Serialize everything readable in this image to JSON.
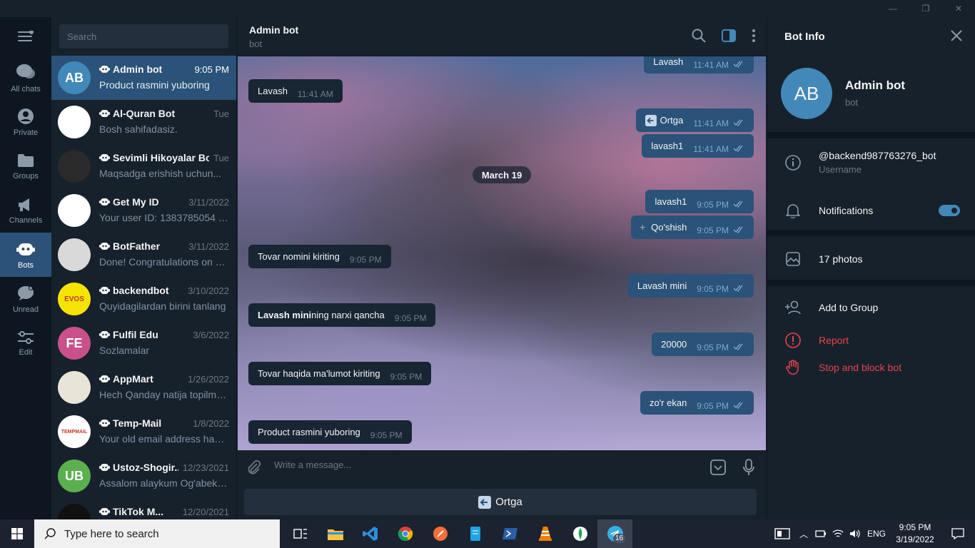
{
  "window": {
    "minimize": "—",
    "maximize": "❐",
    "close": "✕"
  },
  "folders": [
    {
      "label": "All chats",
      "icon": "all-chats-icon",
      "active": false
    },
    {
      "label": "Private",
      "icon": "person-icon",
      "active": false
    },
    {
      "label": "Groups",
      "icon": "folder-icon",
      "active": false
    },
    {
      "label": "Channels",
      "icon": "megaphone-icon",
      "active": false
    },
    {
      "label": "Bots",
      "icon": "bot-icon",
      "active": true
    },
    {
      "label": "Unread",
      "icon": "chat-bubble-icon",
      "active": false
    },
    {
      "label": "Edit",
      "icon": "sliders-icon",
      "active": false
    }
  ],
  "search": {
    "placeholder": "Search"
  },
  "chats": [
    {
      "name": "Admin bot",
      "time": "9:05 PM",
      "message": "Product rasmini yuboring",
      "avatar_text": "AB",
      "avatar_color": "#4288b9",
      "active": true
    },
    {
      "name": "Al-Quran Bot",
      "time": "Tue",
      "message": "Bosh sahifadasiz.",
      "avatar_text": "",
      "avatar_color": "#ffffff"
    },
    {
      "name": "Sevimli Hikoyalar Bot",
      "time": "Tue",
      "message": "Maqsadga erishish uchun...",
      "avatar_text": "",
      "avatar_color": "#2a2a2a"
    },
    {
      "name": "Get My ID",
      "time": "3/11/2022",
      "message": "Your user ID: 1383785054 Cur...",
      "avatar_text": "",
      "avatar_color": "#ffffff"
    },
    {
      "name": "BotFather",
      "time": "3/11/2022",
      "message": "Done! Congratulations on yo...",
      "avatar_text": "",
      "avatar_color": "#d9d9d9"
    },
    {
      "name": "backendbot",
      "time": "3/10/2022",
      "message": "Quyidagilardan birini tanlang",
      "avatar_text": "EVOS",
      "avatar_color": "#f5e400"
    },
    {
      "name": "Fulfil Edu",
      "time": "3/6/2022",
      "message": "Sozlamalar",
      "avatar_text": "FE",
      "avatar_color": "#c9508a"
    },
    {
      "name": "AppMart",
      "time": "1/26/2022",
      "message": "Hech Qanday natija topilmadi.",
      "avatar_text": "",
      "avatar_color": "#e8e4d8"
    },
    {
      "name": "Temp-Mail",
      "time": "1/8/2022",
      "message": "Your old email address has b...",
      "avatar_text": "TEMPMAIL",
      "avatar_color": "#ffffff"
    },
    {
      "name": "Ustoz-Shogir...",
      "time": "12/23/2021",
      "message": "Assalom alaykum Og'abek U...",
      "avatar_text": "UB",
      "avatar_color": "#5caf4f"
    },
    {
      "name": "TikTok M...",
      "time": "12/20/2021",
      "message": "",
      "avatar_text": "",
      "avatar_color": "#111111"
    }
  ],
  "header": {
    "title": "Admin bot",
    "subtitle": "bot"
  },
  "messages": [
    {
      "text": "Lavash",
      "time": "11:41 AM",
      "out": true
    },
    {
      "text": "Lavash",
      "time": "11:41 AM",
      "out": false
    },
    {
      "text": "Ortga",
      "time": "11:41 AM",
      "out": true
    },
    {
      "text": "lavash1",
      "time": "11:41 AM",
      "out": true
    },
    {
      "text": "lavash1",
      "time": "9:05 PM",
      "out": true
    },
    {
      "text": "Qo'shish",
      "time": "9:05 PM",
      "out": true
    },
    {
      "text": "Tovar nomini kiriting",
      "time": "9:05 PM",
      "out": false
    },
    {
      "text": "Lavash mini",
      "time": "9:05 PM",
      "out": true
    },
    {
      "text_bold": "Lavash mini",
      "text": "ning narxi qancha",
      "time": "9:05 PM",
      "out": false
    },
    {
      "text": "20000",
      "time": "9:05 PM",
      "out": true
    },
    {
      "text": "Tovar haqida ma'lumot kiriting",
      "time": "9:05 PM",
      "out": false
    },
    {
      "text": "zo'r ekan",
      "time": "9:05 PM",
      "out": true
    },
    {
      "text": "Product rasmini yuboring",
      "time": "9:05 PM",
      "out": false
    }
  ],
  "date_chip": "March 19",
  "composer": {
    "placeholder": "Write a message..."
  },
  "keyboard": {
    "button": "Ortga"
  },
  "panel": {
    "title": "Bot Info",
    "avatar_text": "AB",
    "name": "Admin bot",
    "subtitle": "bot",
    "username": "@backend987763276_bot",
    "username_label": "Username",
    "notifications": "Notifications",
    "notifications_on": true,
    "photos": "17 photos",
    "add_to_group": "Add to Group",
    "report": "Report",
    "stop_block": "Stop and block bot"
  },
  "taskbar": {
    "search_placeholder": "Type here to search",
    "apps": [
      "task-view-icon",
      "file-explorer-icon",
      "vscode-icon",
      "chrome-icon",
      "postman-icon",
      "notepad-icon",
      "powershell-icon",
      "vlc-icon",
      "mongodb-compass-icon",
      "telegram-icon"
    ],
    "telegram_badge": "16",
    "lang": "ENG",
    "time": "9:05 PM",
    "date": "3/19/2022"
  },
  "colors": {
    "accent": "#4288b9",
    "selected": "#2b5278",
    "bg": "#17212b",
    "danger": "#e5434a"
  }
}
